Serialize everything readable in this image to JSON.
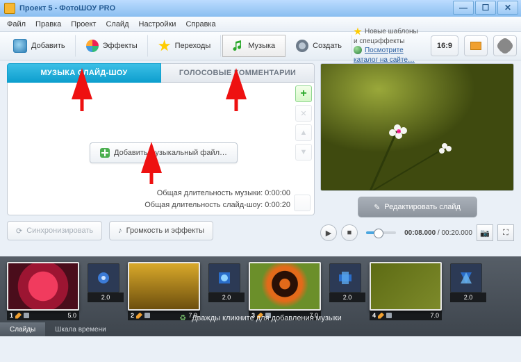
{
  "window": {
    "title": "Проект 5 - ФотоШОУ PRO"
  },
  "menu": [
    "Файл",
    "Правка",
    "Проект",
    "Слайд",
    "Настройки",
    "Справка"
  ],
  "toolbar": {
    "add": "Добавить",
    "effects": "Эффекты",
    "transitions": "Переходы",
    "music": "Музыка",
    "create": "Создать"
  },
  "promo": {
    "line1": "Новые шаблоны и спецэффекты",
    "link": "Посмотрите каталог на сайте…"
  },
  "aspect": "16:9",
  "subtabs": {
    "music": "МУЗЫКА СЛАЙД-ШОУ",
    "voice": "ГОЛОСОВЫЕ КОММЕНТАРИИ"
  },
  "add_music": "Добавить музыкальный файл…",
  "stats": {
    "music_label": "Общая длительность музыки:",
    "music_value": "0:00:00",
    "show_label": "Общая длительность слайд-шоу:",
    "show_value": "0:00:20"
  },
  "buttons": {
    "sync": "Синхронизировать",
    "volume": "Громкость и эффекты"
  },
  "edit_slide": "Редактировать слайд",
  "time": {
    "current": "00:08.000",
    "sep": " / ",
    "total": "00:20.000"
  },
  "timeline": {
    "hint": "Дважды кликните для добавления музыки",
    "tabs": {
      "slides": "Слайды",
      "timescale": "Шкала времени"
    },
    "clips": [
      {
        "n": "1",
        "dur": "5.0",
        "tr": "2.0"
      },
      {
        "n": "2",
        "dur": "7.0",
        "tr": "2.0"
      },
      {
        "n": "3",
        "dur": "7.0",
        "tr": "2.0"
      },
      {
        "n": "4",
        "dur": "7.0",
        "tr": "2.0"
      }
    ]
  }
}
